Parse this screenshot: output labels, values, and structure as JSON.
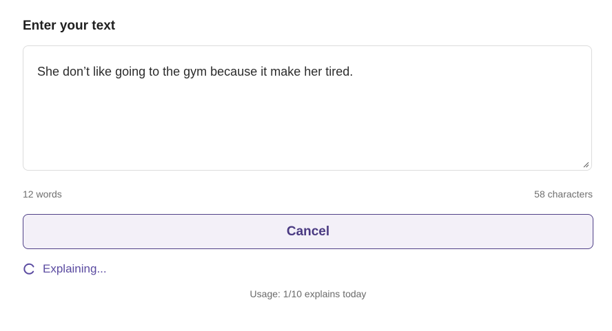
{
  "input": {
    "heading": "Enter your text",
    "value": "She don’t like going to the gym because it make her tired.",
    "word_count": "12 words",
    "char_count": "58 characters"
  },
  "actions": {
    "cancel_label": "Cancel"
  },
  "status": {
    "text": "Explaining...",
    "icon": "spinner-icon"
  },
  "usage": {
    "text": "Usage: 1/10 explains today"
  },
  "colors": {
    "accent": "#4a3a82",
    "button_bg": "#f3f0f8",
    "border": "#dcdcdc",
    "muted_text": "#6f6f6f"
  }
}
